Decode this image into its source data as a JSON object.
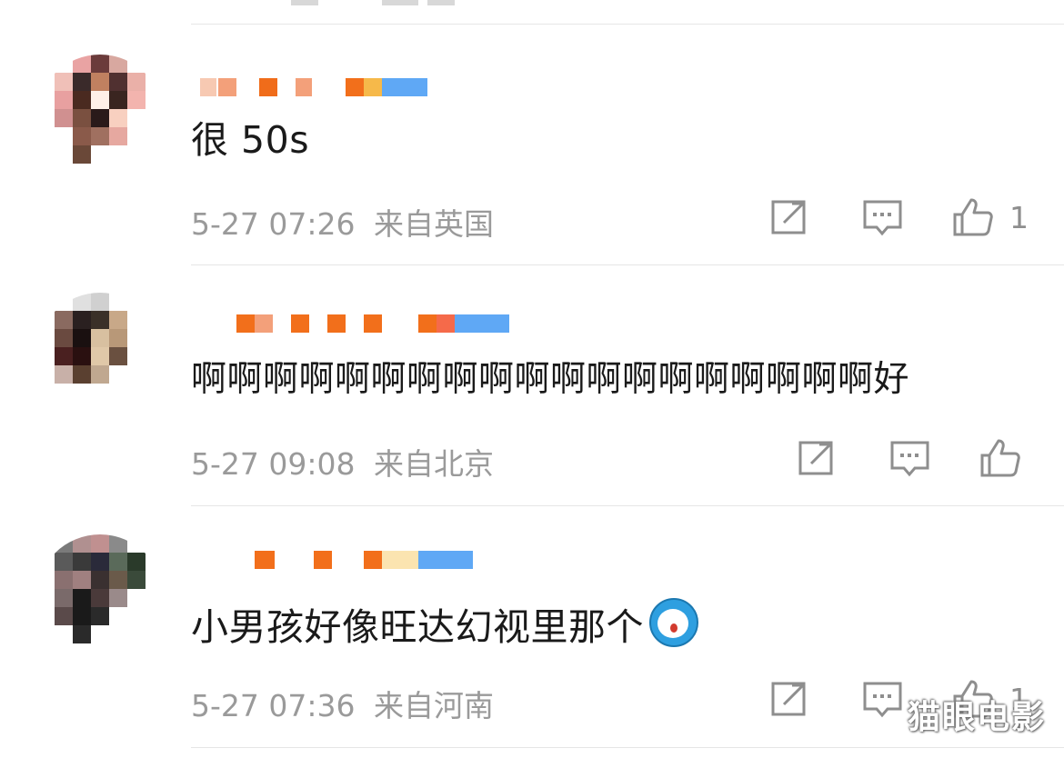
{
  "comments": [
    {
      "text": "很 50s",
      "date": "5-27 07:26",
      "location": "来自英国",
      "likes": "1",
      "avatar_colors": [
        "#ffffff",
        "#e9a3a3",
        "#6b3b3b",
        "#d8a8a0",
        "#ffffff",
        "#f0c0b8",
        "#3a2a2a",
        "#c08060",
        "#503030",
        "#eab0a8",
        "#e8a0a0",
        "#4a2a20",
        "#fff0e8",
        "#3a2520",
        "#f3b4ae",
        "#d09090",
        "#7a5040",
        "#2a1a1a",
        "#f8d0c0",
        "#ffffff",
        "#ffffff",
        "#8a5a4a",
        "#a07060",
        "#e6a8a0",
        "#ffffff",
        "#ffffff",
        "#6a4838",
        "#ffffff",
        "#ffffff",
        "#ffffff"
      ],
      "name_colors": [
        "#f7c9b2",
        "#f3a07a",
        "#f06c1a",
        "#f3a07a",
        "#f26f1b",
        "#f6b94a",
        "#5fa8f5"
      ]
    },
    {
      "text": "啊啊啊啊啊啊啊啊啊啊啊啊啊啊啊啊啊啊啊好",
      "date": "5-27 09:08",
      "location": "来自北京",
      "likes": "",
      "avatar_colors": [
        "#ffffff",
        "#e0e0e0",
        "#d0d0d0",
        "#ffffff",
        "#ffffff",
        "#8a6a60",
        "#2a2020",
        "#3a3028",
        "#c8a888",
        "#ffffff",
        "#6a4a40",
        "#1a1010",
        "#d8c0a0",
        "#b89878",
        "#ffffff",
        "#4a2020",
        "#2a1010",
        "#e0c8a8",
        "#6a5040",
        "#ffffff",
        "#c8b0a8",
        "#5a4030",
        "#c0a890",
        "#ffffff",
        "#ffffff",
        "#ffffff",
        "#ffffff",
        "#ffffff",
        "#ffffff",
        "#ffffff"
      ],
      "name_colors": [
        "#f26f1b",
        "#f3a07a",
        "#f26f1b",
        "#f26f1b",
        "#f26f1b",
        "#f26f1b",
        "#f56a4a",
        "#5fa8f5"
      ]
    },
    {
      "text": "小男孩好像旺达幻视里那个",
      "date": "5-27 07:36",
      "location": "来自河南",
      "likes": "1",
      "avatar_colors": [
        "#7a7a7a",
        "#b09090",
        "#c09090",
        "#8a8a8a",
        "#ffffff",
        "#5a5a5a",
        "#3a3a3a",
        "#2a2a3a",
        "#5a6a5a",
        "#2a3a2a",
        "#8a7070",
        "#a08080",
        "#3a3030",
        "#6a5a4a",
        "#3a4a3a",
        "#7a6a6a",
        "#1a1a1a",
        "#4a3a3a",
        "#9a8a8a",
        "#ffffff",
        "#5a4a4a",
        "#1a1a1a",
        "#2a2a2a",
        "#ffffff",
        "#ffffff",
        "#ffffff",
        "#2a2a2a",
        "#ffffff",
        "#ffffff",
        "#ffffff"
      ],
      "name_colors": [
        "#f26f1b",
        "#f26f1b",
        "#f26f1b",
        "#fbe4b0",
        "#5fa8f5"
      ]
    }
  ],
  "icons": {
    "repost": "repost-icon",
    "reply": "comment-icon",
    "like": "thumbs-up-icon"
  },
  "watermark": "猫眼电影"
}
